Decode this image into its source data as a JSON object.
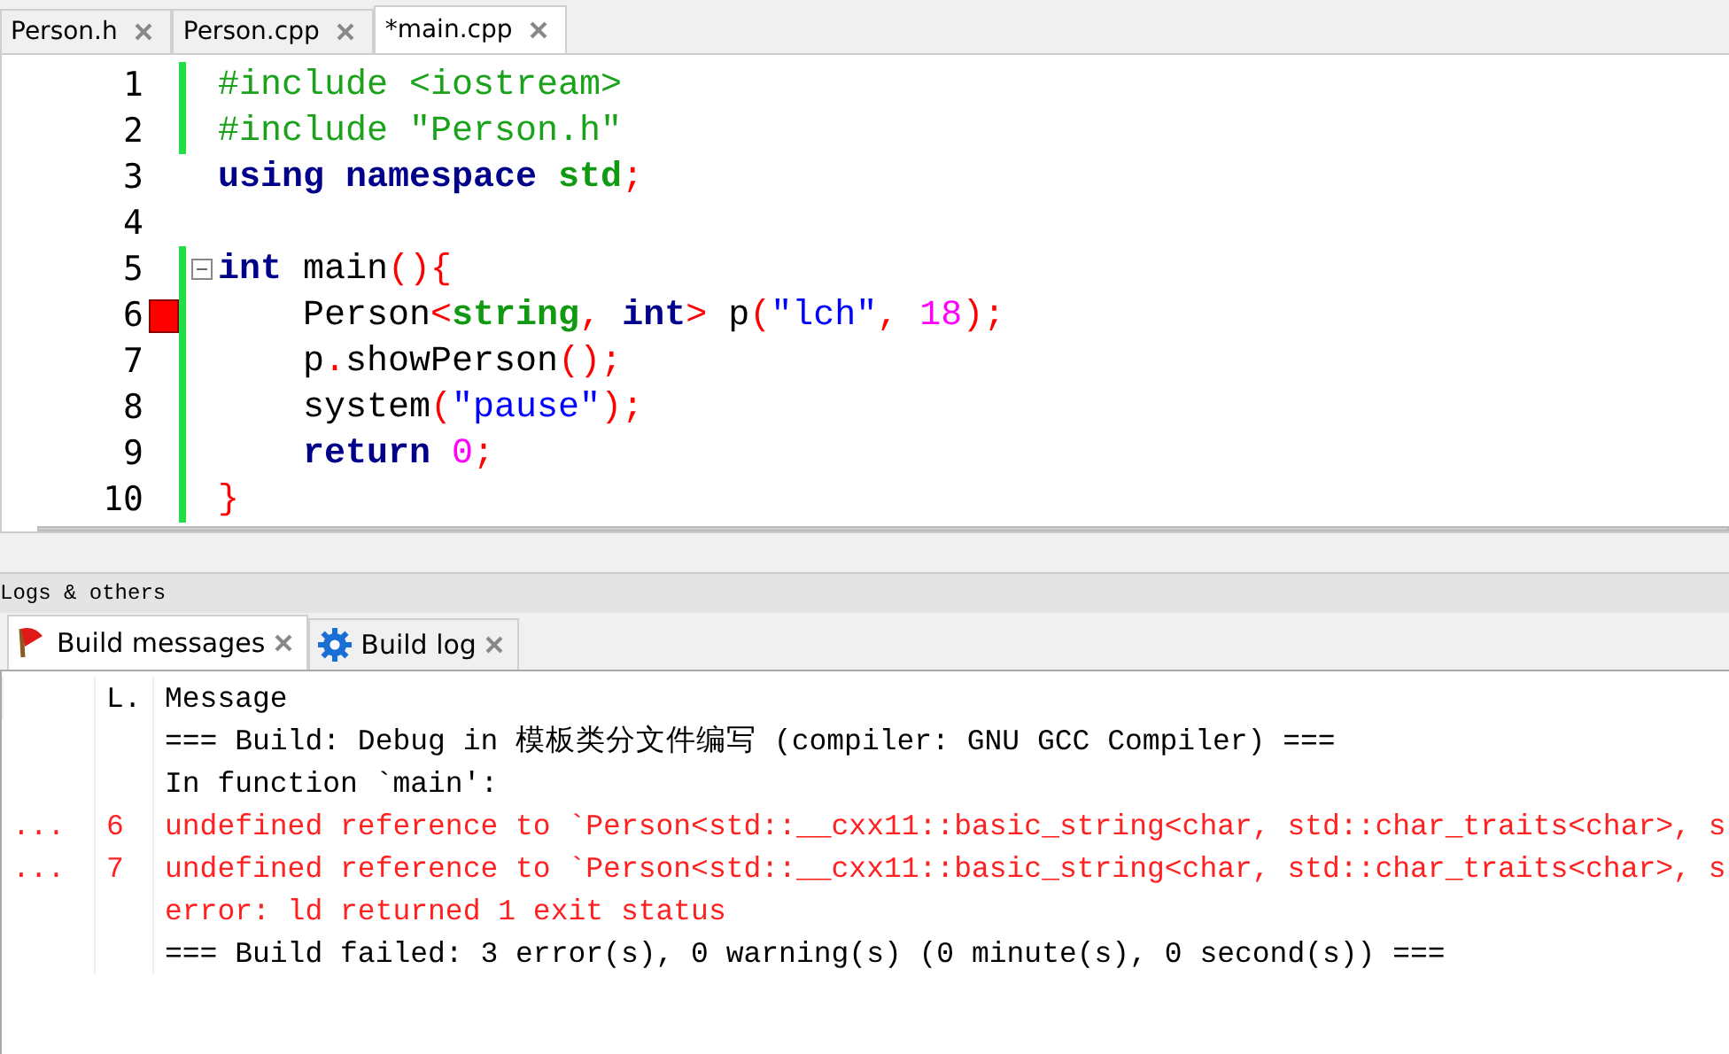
{
  "editor_tabs": [
    {
      "label": "Person.h",
      "selected": false
    },
    {
      "label": "Person.cpp",
      "selected": false
    },
    {
      "label": "*main.cpp",
      "selected": true
    }
  ],
  "code_lines": [
    {
      "number": "1",
      "changed": true,
      "error": false,
      "fold": false,
      "tokens": [
        {
          "text": "#include <iostream>",
          "kind": "preproc"
        }
      ]
    },
    {
      "number": "2",
      "changed": true,
      "error": false,
      "fold": false,
      "tokens": [
        {
          "text": "#include \"Person.h\"",
          "kind": "preproc"
        }
      ]
    },
    {
      "number": "3",
      "changed": false,
      "error": false,
      "fold": false,
      "tokens": [
        {
          "text": "using ",
          "kind": "keyword"
        },
        {
          "text": "namespace ",
          "kind": "keyword"
        },
        {
          "text": "std",
          "kind": "type"
        },
        {
          "text": ";",
          "kind": "op"
        }
      ]
    },
    {
      "number": "4",
      "changed": false,
      "error": false,
      "fold": false
    },
    {
      "number": "5",
      "changed": true,
      "error": false,
      "fold": true,
      "tokens": [
        {
          "text": "int",
          "kind": "keyword"
        },
        {
          "text": " main",
          "kind": "plain"
        },
        {
          "text": "(){",
          "kind": "op"
        }
      ]
    },
    {
      "number": "6",
      "changed": true,
      "error": true,
      "fold": false,
      "tokens": [
        {
          "text": "    Person",
          "kind": "plain"
        },
        {
          "text": "<",
          "kind": "op"
        },
        {
          "text": "string",
          "kind": "type"
        },
        {
          "text": ", ",
          "kind": "op"
        },
        {
          "text": "int",
          "kind": "keyword"
        },
        {
          "text": ">",
          "kind": "op"
        },
        {
          "text": " p",
          "kind": "plain"
        },
        {
          "text": "(",
          "kind": "op"
        },
        {
          "text": "\"lch\"",
          "kind": "string"
        },
        {
          "text": ", ",
          "kind": "op"
        },
        {
          "text": "18",
          "kind": "number"
        },
        {
          "text": ");",
          "kind": "op"
        }
      ]
    },
    {
      "number": "7",
      "changed": true,
      "error": false,
      "fold": false,
      "tokens": [
        {
          "text": "    p",
          "kind": "plain"
        },
        {
          "text": ".",
          "kind": "op"
        },
        {
          "text": "showPerson",
          "kind": "plain"
        },
        {
          "text": "();",
          "kind": "op"
        }
      ]
    },
    {
      "number": "8",
      "changed": true,
      "error": false,
      "fold": false,
      "tokens": [
        {
          "text": "    system",
          "kind": "plain"
        },
        {
          "text": "(",
          "kind": "op"
        },
        {
          "text": "\"pause\"",
          "kind": "string"
        },
        {
          "text": ");",
          "kind": "op"
        }
      ]
    },
    {
      "number": "9",
      "changed": true,
      "error": false,
      "fold": false,
      "tokens": [
        {
          "text": "    return",
          "kind": "keyword"
        },
        {
          "text": " 0",
          "kind": "number"
        },
        {
          "text": ";",
          "kind": "op"
        }
      ]
    },
    {
      "number": "10",
      "changed": true,
      "error": false,
      "fold": false,
      "tokens": [
        {
          "text": "}",
          "kind": "op"
        }
      ]
    }
  ],
  "logs_panel": {
    "title": "Logs & others",
    "tabs": [
      {
        "label": "Build messages",
        "selected": true
      },
      {
        "label": "Build log",
        "selected": false
      }
    ],
    "columns": [
      {
        "label": "L."
      },
      {
        "label": "Message"
      }
    ],
    "rows": [
      {
        "file": "",
        "line": "",
        "message": "=== Build: Debug in 模板类分文件编写 (compiler: GNU GCC Compiler) ===",
        "error": false
      },
      {
        "file": "",
        "line": "",
        "message": "In function `main':",
        "error": false
      },
      {
        "file": "...",
        "line": "6",
        "message": "undefined reference to `Person<std::__cxx11::basic_string<char, std::char_traits<char>, s",
        "error": true
      },
      {
        "file": "...",
        "line": "7",
        "message": "undefined reference to `Person<std::__cxx11::basic_string<char, std::char_traits<char>, s",
        "error": true
      },
      {
        "file": "",
        "line": "",
        "message": "error: ld returned 1 exit status",
        "error": true
      },
      {
        "file": "",
        "line": "",
        "message": "=== Build failed: 3 error(s), 0 warning(s) (0 minute(s), 0 second(s)) ===",
        "error": false
      }
    ]
  }
}
